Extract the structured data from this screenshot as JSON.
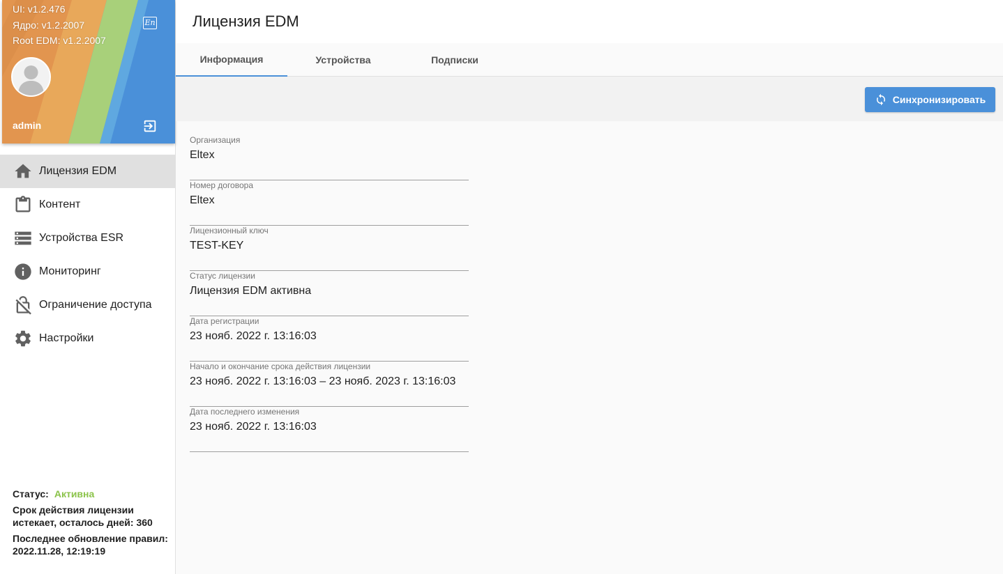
{
  "profile": {
    "versions": [
      "UI: v1.2.476",
      "Ядро: v1.2.2007",
      "Root EDM: v1.2.2007"
    ],
    "lang_icon_text": "En",
    "username": "admin",
    "lang_icon": "language-icon",
    "logout_icon": "logout-icon"
  },
  "nav": {
    "items": [
      {
        "label": "Лицензия EDM",
        "icon": "home-icon",
        "active": true
      },
      {
        "label": "Контент",
        "icon": "clipboard-icon",
        "active": false
      },
      {
        "label": "Устройства ESR",
        "icon": "storage-icon",
        "active": false
      },
      {
        "label": "Мониторинг",
        "icon": "info-icon",
        "active": false
      },
      {
        "label": "Ограничение доступа",
        "icon": "lock-off-icon",
        "active": false
      },
      {
        "label": "Настройки",
        "icon": "gear-icon",
        "active": false
      }
    ]
  },
  "sidebar_status": {
    "status_label": "Статус:",
    "status_value": "Активна",
    "license_expiry": "Срок действия лицензии истекает, осталось дней: 360",
    "rules_update": "Последнее обновление правил: 2022.11.28, 12:19:19"
  },
  "header": {
    "title": "Лицензия EDM"
  },
  "tabs": [
    {
      "label": "Информация",
      "active": true
    },
    {
      "label": "Устройства",
      "active": false
    },
    {
      "label": "Подписки",
      "active": false
    }
  ],
  "toolbar": {
    "sync_label": "Синхронизировать",
    "sync_icon": "sync-icon"
  },
  "fields": [
    {
      "label": "Организация",
      "value": "Eltex"
    },
    {
      "label": "Номер договора",
      "value": "Eltex"
    },
    {
      "label": "Лицензионный ключ",
      "value": "TEST-KEY"
    },
    {
      "label": "Статус лицензии",
      "value": "Лицензия EDM активна"
    },
    {
      "label": "Дата регистрации",
      "value": "23 нояб. 2022 г. 13:16:03"
    },
    {
      "label": "Начало и окончание срока действия лицензии",
      "value": "23 нояб. 2022 г. 13:16:03 – 23 нояб. 2023 г. 13:16:03"
    },
    {
      "label": "Дата последнего изменения",
      "value": "23 нояб. 2022 г. 13:16:03"
    }
  ],
  "colors": {
    "accent": "#4a90d9",
    "status_active": "#8bc34a"
  }
}
